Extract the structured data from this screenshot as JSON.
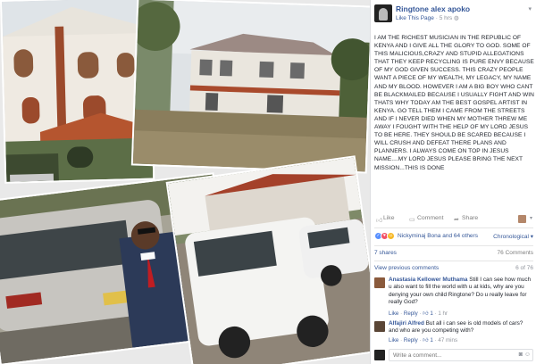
{
  "post": {
    "page_name": "Ringtone alex apoko",
    "like_page_label": "Like This Page",
    "time_ago": "5 hrs",
    "body": "I AM THE RICHEST MUSICIAN IN THE REPUBLIC OF KENYA AND I GIVE ALL THE GLORY TO GOD. SOME OF THIS MALICIOUS,CRAZY AND STUPID ALLEGATIONS THAT THEY KEEP RECYCLING IS PURE ENVY BECAUSE OF MY GOD GIVEN SUCCESS. THIS CRAZY PEOPLE WANT A PIECE OF MY WEALTH, MY LEGACY, MY NAME AND MY BLOOD. HOWEVER I AM A BIG BOY WHO CANT BE BLACKMAILED BECAUSE I USUALLY FIGHT AND WIN THATS WHY TODAY AM THE BEST GOSPEL ARTIST IN KENYA. GO TELL THEM I CAME FROM THE STREETS AND IF I NEVER DIED WHEN MY MOTHER THREW ME AWAY I FOUGHT WITH THE HELP OF MY LORD JESUS TO BE HERE. THEY SHOULD BE SCARED BECAUSE I WILL CRUSH AND DEFEAT THERE PLANS AND PLANNERS. I ALWAYS COME ON TOP IN JESUS NAME....MY LORD JESUS PLEASE BRING THE NEXT MISSION...THIS IS DONE"
  },
  "actions": {
    "like": "Like",
    "comment": "Comment",
    "share": "Share"
  },
  "reactions": {
    "names": "Nickyminaj Bona and 64 others",
    "order": "Chronological"
  },
  "counts": {
    "shares": "7 shares",
    "comments": "76 Comments"
  },
  "comments_nav": {
    "view_previous": "View previous comments",
    "position": "6 of 76"
  },
  "comments": [
    {
      "author": "Anastasia Kellower Muthama",
      "text": "Still I can see how much u also want to fill the world with u at kids, why are you denying your own child Ringtone? Do u really leave for really God?",
      "like": "Like",
      "reply": "Reply",
      "likes": "1",
      "time": "1 hr"
    },
    {
      "author": "Alfajiri Alfred",
      "text": "But all i can see is old models of cars?and who are you competing with?",
      "like": "Like",
      "reply": "Reply",
      "likes": "1",
      "time": "47 mins"
    }
  ],
  "write_comment": {
    "placeholder": "Write a comment..."
  },
  "colors": {
    "link": "#365899",
    "muted": "#90949c",
    "like_reaction": "#5890ff",
    "love_reaction": "#f25268"
  },
  "icons": {
    "like": "thumbs-up-icon",
    "comment": "speech-bubble-icon",
    "share": "share-arrow-icon",
    "camera": "camera-icon",
    "sticker": "sticker-icon"
  }
}
